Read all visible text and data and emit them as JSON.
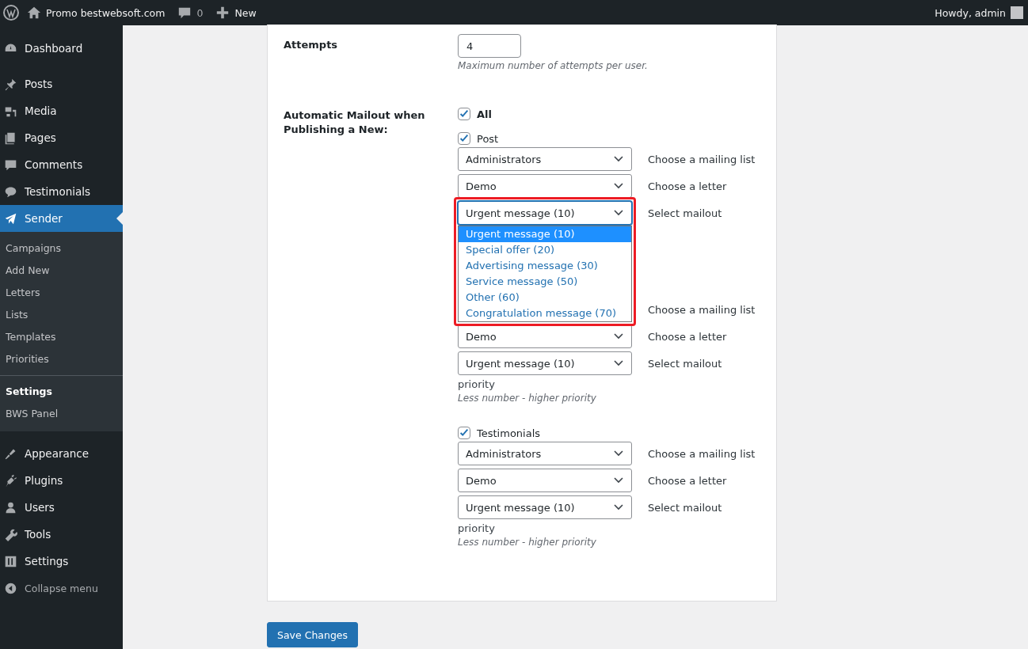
{
  "admin_bar": {
    "site": "Promo bestwebsoft.com",
    "comments": "0",
    "new": "New",
    "greeting": "Howdy, admin"
  },
  "menu": [
    {
      "label": "Dashboard",
      "selected": false
    },
    {
      "label": "Posts",
      "selected": false
    },
    {
      "label": "Media",
      "selected": false
    },
    {
      "label": "Pages",
      "selected": false
    },
    {
      "label": "Comments",
      "selected": false
    },
    {
      "label": "Testimonials",
      "selected": false
    },
    {
      "label": "Sender",
      "selected": true,
      "children": [
        {
          "label": "Campaigns",
          "selected": false
        },
        {
          "label": "Add New",
          "selected": false
        },
        {
          "label": "Letters",
          "selected": false
        },
        {
          "label": "Lists",
          "selected": false
        },
        {
          "label": "Templates",
          "selected": false
        },
        {
          "label": "Priorities",
          "selected": false
        },
        {
          "label": "Settings",
          "selected": true
        },
        {
          "label": "BWS Panel",
          "selected": false
        }
      ]
    },
    {
      "label": "Appearance",
      "selected": false
    },
    {
      "label": "Plugins",
      "selected": false
    },
    {
      "label": "Users",
      "selected": false
    },
    {
      "label": "Tools",
      "selected": false
    },
    {
      "label": "Settings",
      "selected": false
    },
    {
      "label": "Collapse menu",
      "selected": false
    }
  ],
  "attempts": {
    "label": "Attempts",
    "value": "4",
    "hint": "Maximum number of attempts per user."
  },
  "mailout": {
    "label": "Automatic Mailout when Publishing a New:",
    "all": {
      "label": "All",
      "checked": true
    },
    "groups": [
      {
        "checkbox": {
          "label": "Post",
          "checked": true
        },
        "rows": [
          {
            "value": "Administrators",
            "label": "Choose a mailing list"
          },
          {
            "value": "Demo",
            "label": "Choose a letter"
          },
          {
            "value": "Urgent message (10)",
            "label": "Select mailout",
            "open": true,
            "options": [
              {
                "label": "Urgent message (10)",
                "selected": true
              },
              {
                "label": "Special offer (20)",
                "selected": false
              },
              {
                "label": "Advertising message (30)",
                "selected": false
              },
              {
                "label": "Service message (50)",
                "selected": false
              },
              {
                "label": "Other (60)",
                "selected": false
              },
              {
                "label": "Congratulation message (70)",
                "selected": false
              }
            ]
          }
        ]
      },
      {
        "rows": [
          {
            "label": "Choose a mailing list"
          },
          {
            "value": "Demo",
            "label": "Choose a letter"
          },
          {
            "value": "Urgent message (10)",
            "label": "Select mailout"
          }
        ],
        "priority": "priority",
        "hint": "Less number - higher priority"
      },
      {
        "checkbox": {
          "label": "Testimonials",
          "checked": true
        },
        "rows": [
          {
            "value": "Administrators",
            "label": "Choose a mailing list"
          },
          {
            "value": "Demo",
            "label": "Choose a letter"
          },
          {
            "value": "Urgent message (10)",
            "label": "Select mailout"
          }
        ],
        "priority": "priority",
        "hint": "Less number - higher priority"
      }
    ]
  },
  "save_button": "Save Changes"
}
